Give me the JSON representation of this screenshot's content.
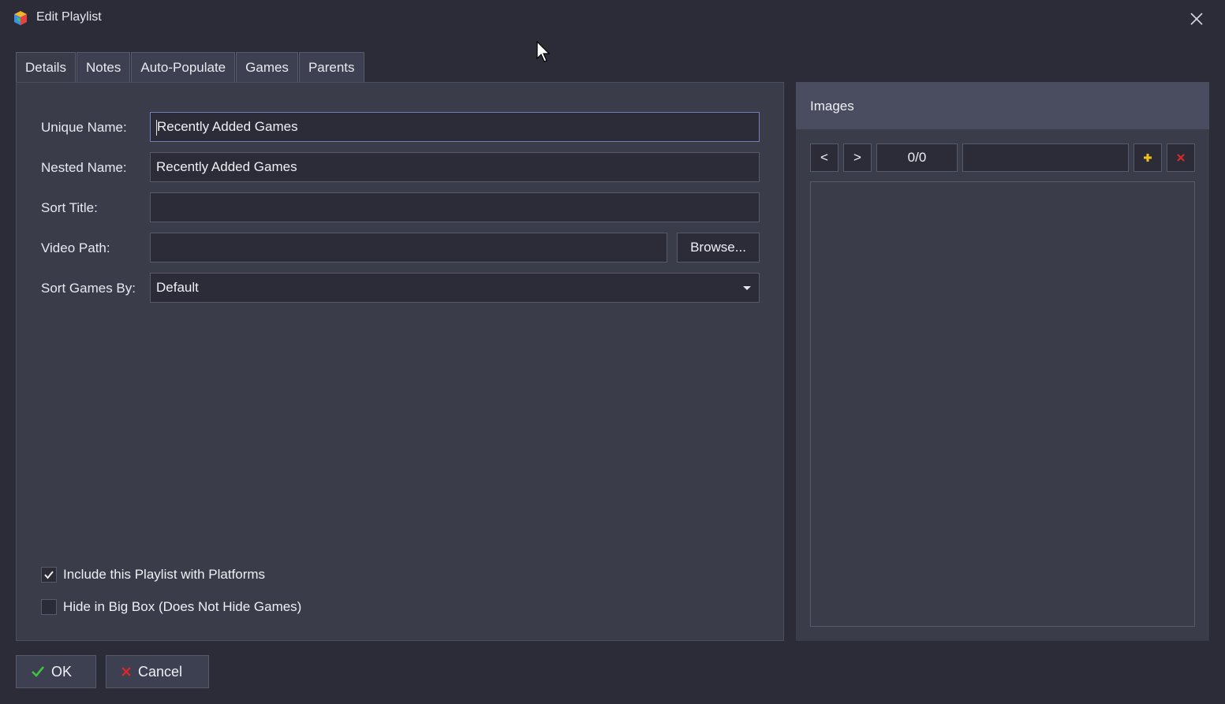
{
  "window": {
    "title": "Edit Playlist"
  },
  "tabs": [
    {
      "label": "Details",
      "active": true
    },
    {
      "label": "Notes"
    },
    {
      "label": "Auto-Populate"
    },
    {
      "label": "Games"
    },
    {
      "label": "Parents"
    }
  ],
  "details": {
    "unique_name": {
      "label": "Unique Name:",
      "value": "Recently Added Games"
    },
    "nested_name": {
      "label": "Nested Name:",
      "value": "Recently Added Games"
    },
    "sort_title": {
      "label": "Sort Title:",
      "value": ""
    },
    "video_path": {
      "label": "Video Path:",
      "value": "",
      "browse_label": "Browse..."
    },
    "sort_games_by": {
      "label": "Sort Games By:",
      "value": "Default"
    },
    "include_with_platforms": {
      "label": "Include this Playlist with Platforms",
      "checked": true
    },
    "hide_in_big_box": {
      "label": "Hide in Big Box (Does Not Hide Games)",
      "checked": false
    }
  },
  "images": {
    "title": "Images",
    "prev_label": "<",
    "next_label": ">",
    "counter": "0/0",
    "type_value": ""
  },
  "footer": {
    "ok_label": "OK",
    "cancel_label": "Cancel"
  },
  "colors": {
    "background": "#2b2c37",
    "panel": "#3a3c4a",
    "input": "#2b2c38",
    "ok_check": "#3ec43e",
    "cancel_x": "#d62a2a",
    "add_icon": "#f0c020"
  }
}
